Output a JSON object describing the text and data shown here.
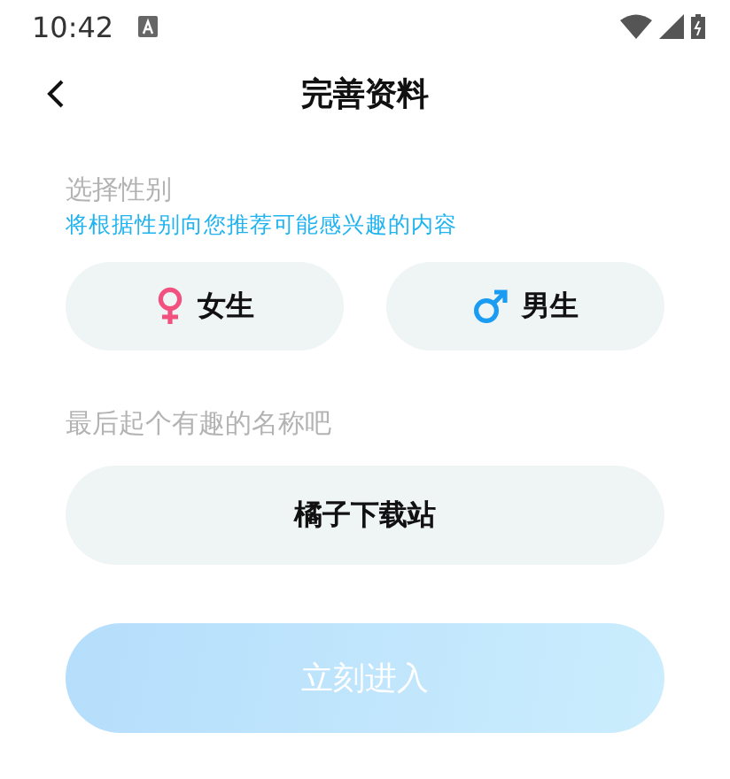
{
  "status_bar": {
    "time": "10:42"
  },
  "header": {
    "title": "完善资料"
  },
  "gender_section": {
    "label": "选择性别",
    "hint": "将根据性别向您推荐可能感兴趣的内容"
  },
  "genders": [
    {
      "kind": "female",
      "label": "女生",
      "selected": false
    },
    {
      "kind": "male",
      "label": "男生",
      "selected": false
    }
  ],
  "name_section": {
    "label": "最后起个有趣的名称吧",
    "value": "橘子下载站"
  },
  "enter_button": {
    "label": "立刻进入",
    "disabled": true
  }
}
